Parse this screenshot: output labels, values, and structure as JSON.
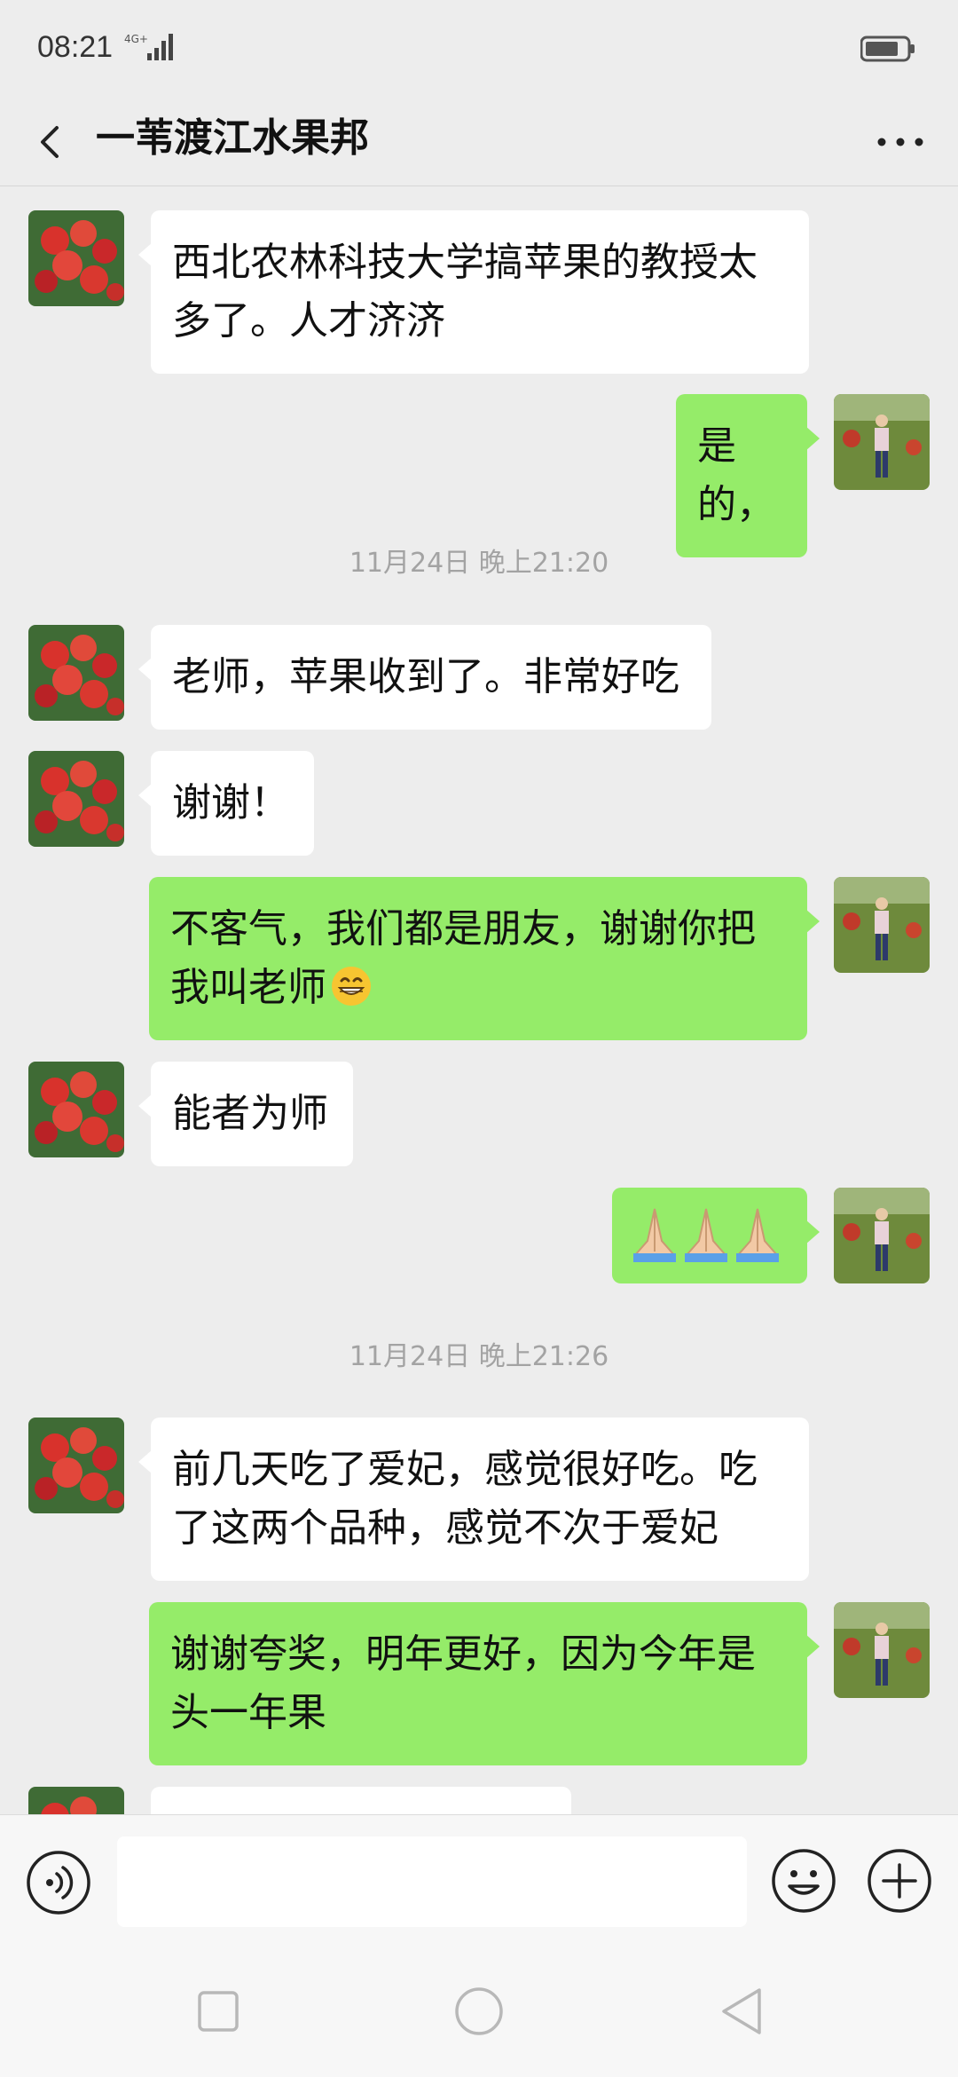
{
  "status_bar": {
    "time": "08:21",
    "network": "4G+",
    "icons": [
      "signal-icon",
      "battery-icon"
    ]
  },
  "header": {
    "title": "一苇渡江水果邦",
    "icons": [
      "back-arrow-icon",
      "more-dots-icon"
    ]
  },
  "messages": [
    {
      "from": "other",
      "text": "西北农林科技大学搞苹果的教授太多了。人才济济"
    },
    {
      "from": "me",
      "text": "是的，"
    },
    {
      "timestamp": "11月24日 晚上21:20"
    },
    {
      "from": "other",
      "text": "老师，苹果收到了。非常好吃"
    },
    {
      "from": "other",
      "text": "谢谢！"
    },
    {
      "from": "me",
      "text": "不客气，我们都是朋友，谢谢你把我叫老师",
      "emoji": "grinning-face-icon"
    },
    {
      "from": "other",
      "text": "能者为师"
    },
    {
      "from": "me",
      "emoji": "folded-hands-icon x3"
    },
    {
      "timestamp": "11月24日 晚上21:26"
    },
    {
      "from": "other",
      "text": "前几天吃了爱妃，感觉很好吃。吃了这两个品种，感觉不次于爱妃"
    },
    {
      "from": "me",
      "text": "谢谢夸奖，明年更好，因为今年是头一年果"
    }
  ],
  "input_bar": {
    "value": "",
    "icons": [
      "voice-icon",
      "emoji-icon",
      "plus-icon"
    ]
  },
  "nav_bar": {
    "icons": [
      "recent-apps-icon",
      "home-icon",
      "back-triangle-icon"
    ]
  },
  "colors": {
    "background": "#ededed",
    "bubble_out": "#95ec69",
    "bubble_in": "#ffffff",
    "timestamp": "#a3a3a3"
  }
}
